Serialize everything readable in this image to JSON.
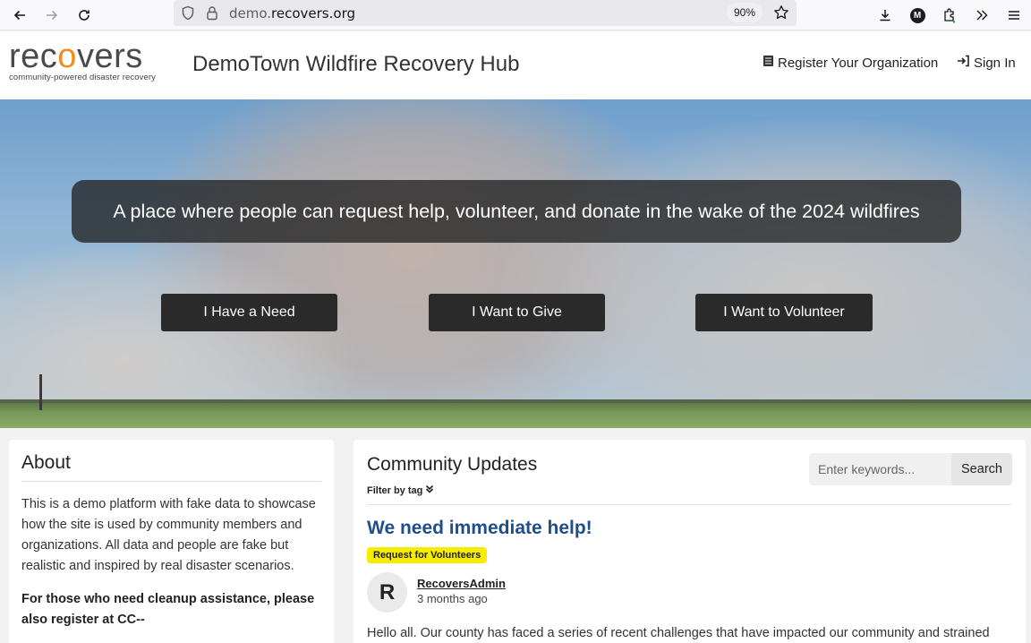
{
  "browser": {
    "url_prefix": "demo.",
    "url_domain": "recovers.org",
    "zoom": "90%",
    "profile_initial": "M"
  },
  "header": {
    "logo_word_start": "rec",
    "logo_word_o": "o",
    "logo_word_end": "vers",
    "logo_tagline": "community-powered disaster recovery",
    "site_title": "DemoTown Wildfire Recovery Hub",
    "register_label": "Register Your Organization",
    "signin_label": "Sign In"
  },
  "hero": {
    "tagline": "A place where people can request help, volunteer, and donate in the wake of the 2024 wildfires",
    "buttons": [
      "I Have a Need",
      "I Want to Give",
      "I Want to Volunteer"
    ]
  },
  "about": {
    "title": "About",
    "paragraph": "This is a demo platform with fake data to showcase how the site is used by community members and organizations. All data and people are fake but realistic and inspired by real disaster scenarios.",
    "bold_paragraph": "For those who need cleanup assistance, please also register at CC--"
  },
  "updates": {
    "title": "Community Updates",
    "filter_label": "Filter by tag",
    "search_placeholder": "Enter keywords...",
    "search_button": "Search",
    "post": {
      "title": "We need immediate help!",
      "tag": "Request for Volunteers",
      "avatar_initial": "R",
      "author": "RecoversAdmin",
      "time": "3 months ago",
      "body": "Hello all. Our county has faced a series of recent challenges that have impacted our community and strained"
    }
  },
  "colors": {
    "accent_orange": "#f28c1e",
    "post_title_blue": "#1f4e8c",
    "tag_yellow": "#f5ec00",
    "cta_dark": "#2a2a2a"
  }
}
